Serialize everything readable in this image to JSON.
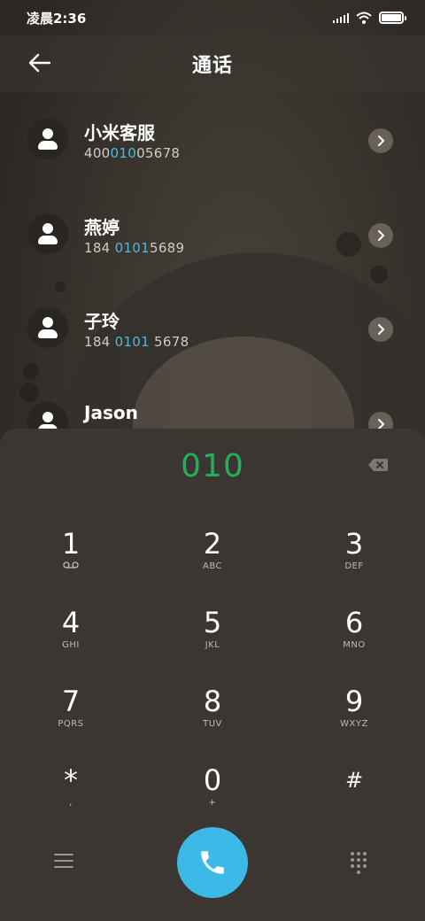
{
  "status": {
    "time": "凌晨2:36",
    "signal_icon": "signal-icon",
    "wifi_icon": "wifi-icon",
    "battery_icon": "battery-icon"
  },
  "header": {
    "title": "通话",
    "back_icon": "arrow-left-icon"
  },
  "contacts": [
    {
      "name": "小米客服",
      "num_pre": "400",
      "num_hl": "010",
      "num_post": "05678"
    },
    {
      "name": "燕婷",
      "num_pre": "184 ",
      "num_hl": "0101",
      "num_post": "5689"
    },
    {
      "name": "子玲",
      "num_pre": "184 ",
      "num_hl": "0101",
      "num_post": " 5678"
    },
    {
      "name": "Jason",
      "num_pre": "",
      "num_hl": "",
      "num_post": ""
    }
  ],
  "dialer": {
    "entered_digits": "010",
    "digit_color": "#22b05a",
    "highlight_color": "#4fb8de",
    "keys": [
      {
        "num": "1",
        "sub": "voicemail-icon"
      },
      {
        "num": "2",
        "sub": "ABC"
      },
      {
        "num": "3",
        "sub": "DEF"
      },
      {
        "num": "4",
        "sub": "GHI"
      },
      {
        "num": "5",
        "sub": "JKL"
      },
      {
        "num": "6",
        "sub": "MNO"
      },
      {
        "num": "7",
        "sub": "PQRS"
      },
      {
        "num": "8",
        "sub": "TUV"
      },
      {
        "num": "9",
        "sub": "WXYZ"
      },
      {
        "num": "*",
        "sub": ","
      },
      {
        "num": "0",
        "sub": "+"
      },
      {
        "num": "#",
        "sub": ""
      }
    ]
  },
  "bottom": {
    "menu_icon": "menu-icon",
    "call_icon": "phone-icon",
    "call_color": "#3cb9e6",
    "keypad_icon": "dialpad-icon"
  }
}
